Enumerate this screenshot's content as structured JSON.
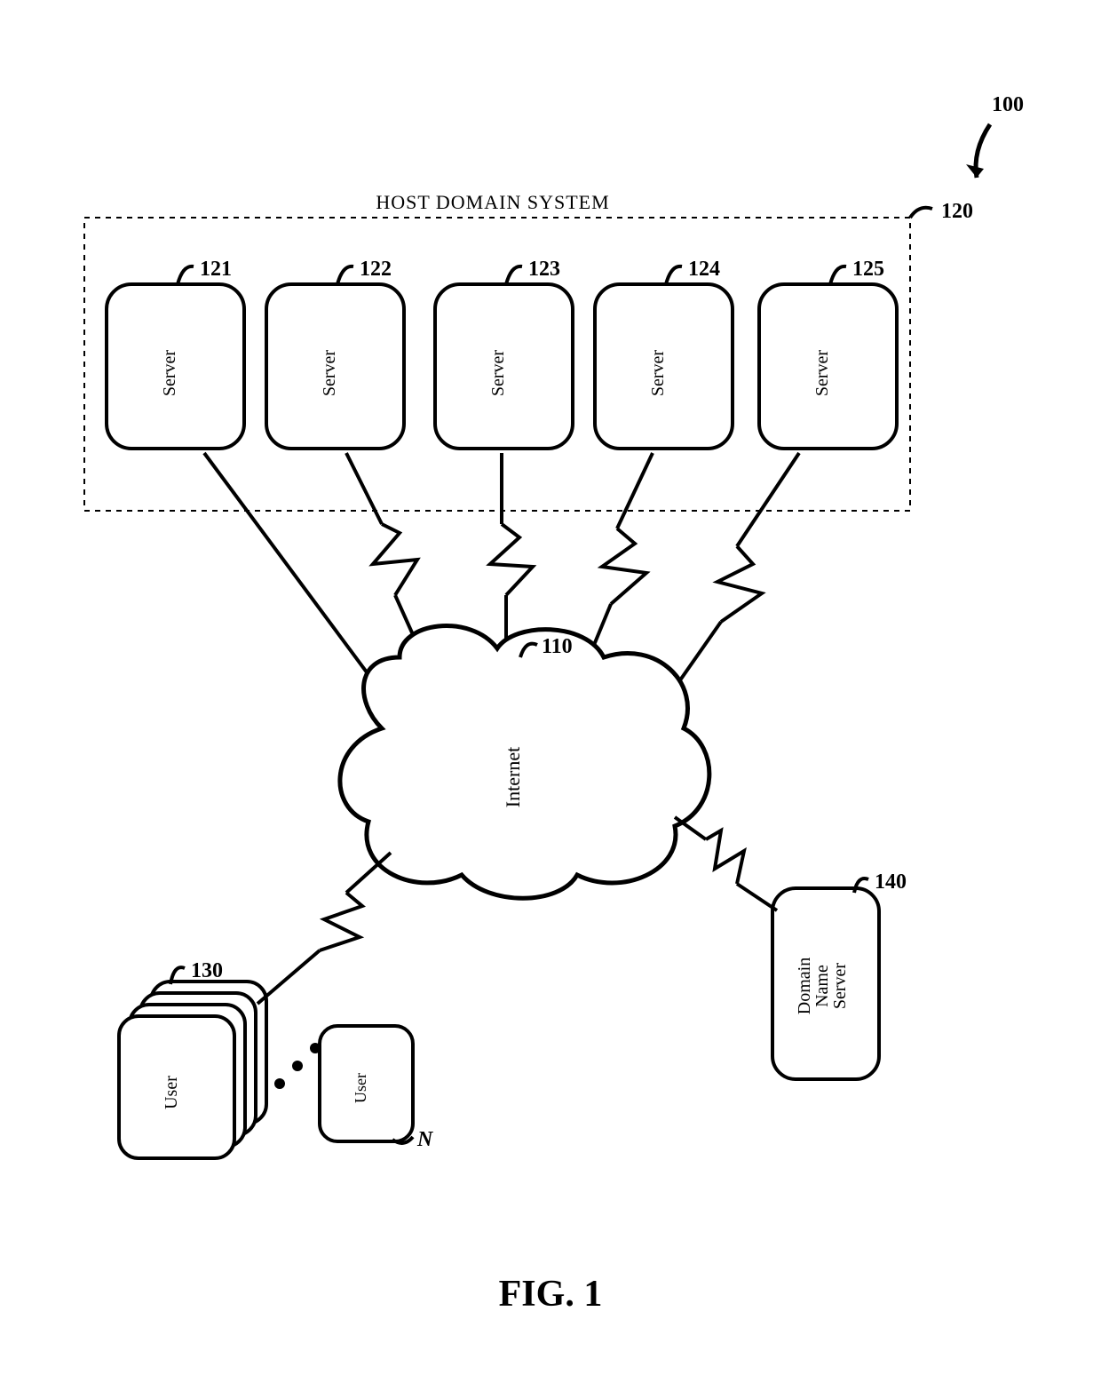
{
  "figure": {
    "label": "FIG. 1",
    "ref_overall": "100",
    "group": {
      "title": "HOST DOMAIN SYSTEM",
      "ref": "120"
    },
    "internet": {
      "label": "Internet",
      "ref": "110"
    },
    "dns": {
      "line1": "Domain",
      "line2": "Name",
      "line3": "Server",
      "ref": "140"
    },
    "servers": [
      {
        "label": "Server",
        "ref": "121"
      },
      {
        "label": "Server",
        "ref": "122"
      },
      {
        "label": "Server",
        "ref": "123"
      },
      {
        "label": "Server",
        "ref": "124"
      },
      {
        "label": "Server",
        "ref": "125"
      }
    ],
    "users": {
      "label_front": "User",
      "label_back": "User",
      "ref_front": "130",
      "ref_back": "N"
    }
  }
}
